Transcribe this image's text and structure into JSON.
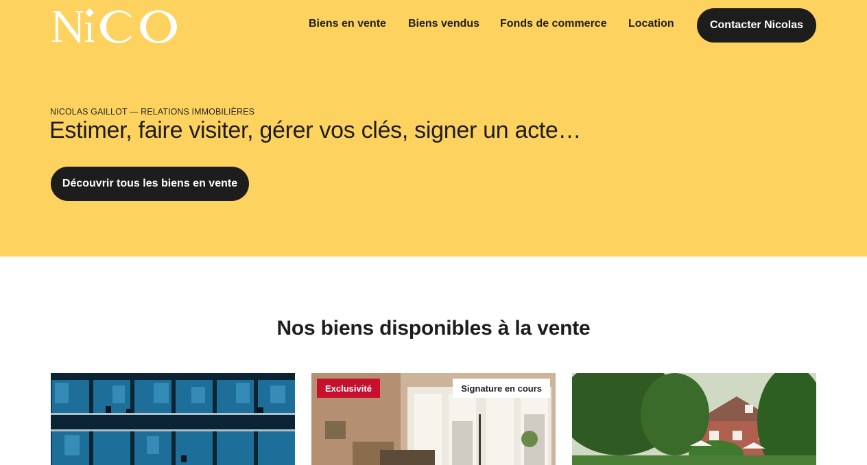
{
  "brand": {
    "logo_text": "NiCO"
  },
  "nav": {
    "items": [
      "Biens en vente",
      "Biens vendus",
      "Fonds de commerce",
      "Location"
    ],
    "contact_label": "Contacter Nicolas"
  },
  "hero": {
    "kicker": "NICOLAS GAILLOT — RELATIONS IMMOBILIÈRES",
    "headline": "Estimer, faire visiter, gérer vos clés, signer un acte…",
    "cta_label": "Découvrir tous les biens en vente"
  },
  "listings": {
    "title": "Nos biens disponibles à la vente",
    "cards": [
      {
        "badges": []
      },
      {
        "badges": [
          "Exclusivité",
          "Signature en cours"
        ]
      },
      {
        "badges": []
      }
    ]
  },
  "colors": {
    "hero_bg": "#fed25f",
    "dark": "#1d1d1d",
    "badge_red": "#c8102e"
  }
}
